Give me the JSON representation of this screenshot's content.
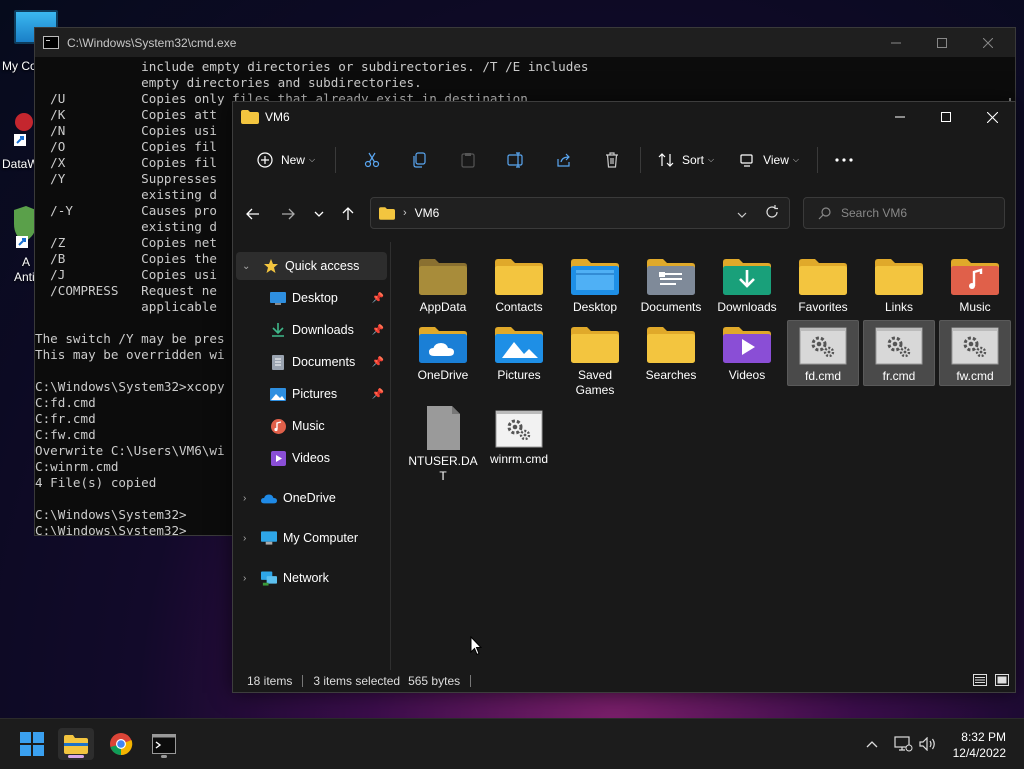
{
  "desktop": {
    "icons": [
      {
        "label": "My Co"
      },
      {
        "label": "DataW"
      },
      {
        "label": "A"
      },
      {
        "label": "Anti"
      }
    ]
  },
  "cmd": {
    "title": "C:\\Windows\\System32\\cmd.exe",
    "lines": [
      "              include empty directories or subdirectories. /T /E includes",
      "              empty directories and subdirectories.",
      "  /U          Copies only files that already exist in destination.",
      "  /K          Copies att",
      "  /N          Copies usi",
      "  /O          Copies fil",
      "  /X          Copies fil",
      "  /Y          Suppresses",
      "              existing d",
      "  /-Y         Causes pro",
      "              existing d",
      "  /Z          Copies net",
      "  /B          Copies the",
      "  /J          Copies usi",
      "  /COMPRESS   Request ne",
      "              applicable",
      "",
      "The switch /Y may be pres",
      "This may be overridden wi",
      "",
      "C:\\Windows\\System32>xcopy",
      "C:fd.cmd",
      "C:fr.cmd",
      "C:fw.cmd",
      "Overwrite C:\\Users\\VM6\\wi",
      "C:winrm.cmd",
      "4 File(s) copied",
      "",
      "C:\\Windows\\System32>",
      "C:\\Windows\\System32>"
    ]
  },
  "explorer": {
    "title": "VM6",
    "toolbar": {
      "new_label": "New",
      "sort_label": "Sort",
      "view_label": "View"
    },
    "address": {
      "path": "VM6"
    },
    "search": {
      "placeholder": "Search VM6"
    },
    "nav": {
      "quick_access": "Quick access",
      "pinned": [
        {
          "label": "Desktop",
          "icon": "desktop-icon",
          "pinned": true
        },
        {
          "label": "Downloads",
          "icon": "downloads-icon",
          "pinned": true
        },
        {
          "label": "Documents",
          "icon": "documents-icon",
          "pinned": true
        },
        {
          "label": "Pictures",
          "icon": "pictures-icon",
          "pinned": true
        },
        {
          "label": "Music",
          "icon": "music-icon",
          "pinned": false
        },
        {
          "label": "Videos",
          "icon": "videos-icon",
          "pinned": false
        }
      ],
      "roots": [
        {
          "label": "OneDrive",
          "icon": "onedrive-icon"
        },
        {
          "label": "My Computer",
          "icon": "computer-icon"
        },
        {
          "label": "Network",
          "icon": "network-icon"
        }
      ]
    },
    "items": [
      {
        "label": "AppData",
        "kind": "folder-dim"
      },
      {
        "label": "Contacts",
        "kind": "folder"
      },
      {
        "label": "Desktop",
        "kind": "folder-desktop"
      },
      {
        "label": "Documents",
        "kind": "folder-documents"
      },
      {
        "label": "Downloads",
        "kind": "folder-downloads"
      },
      {
        "label": "Favorites",
        "kind": "folder"
      },
      {
        "label": "Links",
        "kind": "folder"
      },
      {
        "label": "Music",
        "kind": "folder-music"
      },
      {
        "label": "OneDrive",
        "kind": "folder-onedrive"
      },
      {
        "label": "Pictures",
        "kind": "folder-pictures"
      },
      {
        "label": "Saved Games",
        "kind": "folder"
      },
      {
        "label": "Searches",
        "kind": "folder"
      },
      {
        "label": "Videos",
        "kind": "folder-videos"
      },
      {
        "label": "fd.cmd",
        "kind": "cmd-file",
        "selected": true
      },
      {
        "label": "fr.cmd",
        "kind": "cmd-file",
        "selected": true
      },
      {
        "label": "fw.cmd",
        "kind": "cmd-file",
        "selected": true
      },
      {
        "label": "NTUSER.DAT",
        "kind": "file"
      },
      {
        "label": "winrm.cmd",
        "kind": "cmd-file-white"
      }
    ],
    "status": {
      "count": "18 items",
      "selected": "3 items selected",
      "size": "565 bytes"
    }
  },
  "taskbar": {
    "apps": [
      {
        "name": "start-button"
      },
      {
        "name": "file-explorer"
      },
      {
        "name": "chrome"
      },
      {
        "name": "command-prompt"
      }
    ],
    "time": "8:32 PM",
    "date": "12/4/2022"
  },
  "colors": {
    "folder": "#f3c53f",
    "folder_dark": "#d9a521",
    "accent_blue": "#0f7ad8",
    "explorer_bg": "#191919"
  }
}
